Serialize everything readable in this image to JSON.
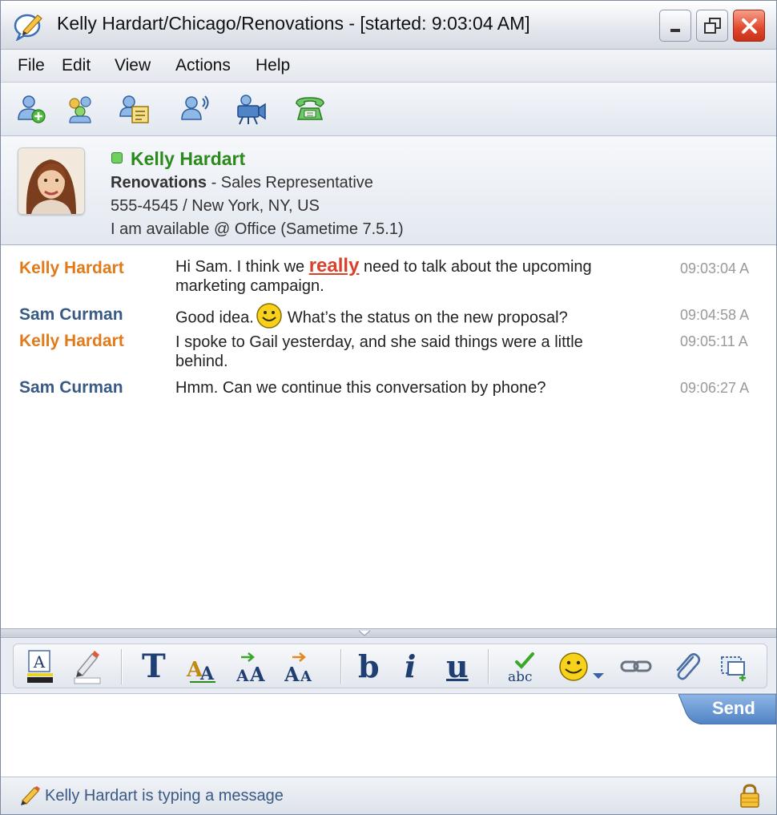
{
  "window": {
    "title": "Kelly Hardart/Chicago/Renovations - [started: 9:03:04 AM]"
  },
  "menu": [
    "File",
    "Edit",
    "View",
    "Actions",
    "Help"
  ],
  "toolbar_icons": [
    "add-contact-icon",
    "group-chat-icon",
    "share-screen-icon",
    "voice-call-icon",
    "video-call-icon",
    "phone-icon"
  ],
  "contact": {
    "name": "Kelly Hardart",
    "company": "Renovations",
    "role": " - Sales Representative",
    "phone_location": "555-4545 / New York, NY, US",
    "status": "I am available @ Office (Sametime 7.5.1)",
    "status_color": "#6fcf5f"
  },
  "messages": [
    {
      "sender": "Kelly Hardart",
      "text_before": "Hi Sam. I think we ",
      "emphasis": "really",
      "text_after": " need to talk about the upcoming marketing campaign.",
      "time": "09:03:04 A"
    },
    {
      "sender": "Sam Curman",
      "text_before": "Good idea.",
      "text_after": "What’s the status on the new proposal?",
      "time": "09:04:58 A"
    },
    {
      "sender": "Kelly Hardart",
      "text": "I spoke to Gail yesterday, and she said things were a little behind.",
      "time": "09:05:11 A"
    },
    {
      "sender": "Sam Curman",
      "text": "Hmm. Can we continue this conversation by phone?",
      "time": "09:06:27 A"
    }
  ],
  "format_bar": {
    "text_style": "T",
    "bold": "b",
    "italic": "i",
    "underline": "u"
  },
  "send_label": "Send",
  "status_bar": {
    "typing": "Kelly Hardart is typing a message"
  },
  "colors": {
    "kelly": "#e27a1a",
    "sam": "#3a5a86",
    "emphasis": "#d8412a",
    "online_name": "#2a8a1c"
  }
}
